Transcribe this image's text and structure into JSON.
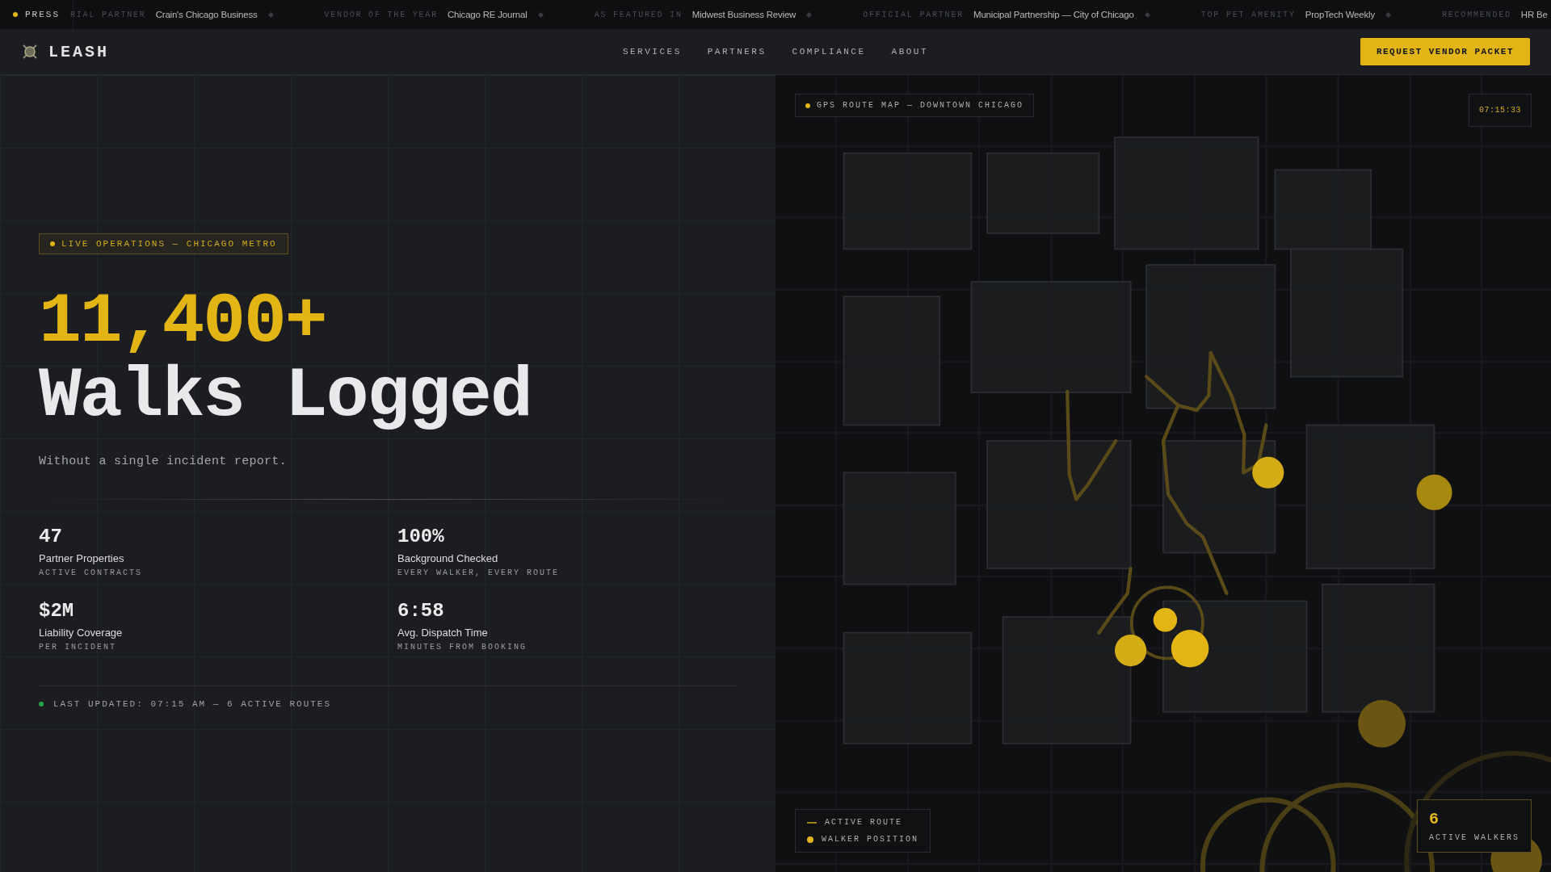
{
  "ticker": {
    "label": "PRESS",
    "items": [
      {
        "tag": "RIAL PARTNER",
        "source": "Crain's Chicago Business"
      },
      {
        "tag": "VENDOR OF THE YEAR",
        "source": "Chicago RE Journal"
      },
      {
        "tag": "AS FEATURED IN",
        "source": "Midwest Business Review"
      },
      {
        "tag": "OFFICIAL PARTNER",
        "source": "Municipal Partnership — City of Chicago"
      },
      {
        "tag": "TOP PET AMENITY",
        "source": "PropTech Weekly"
      },
      {
        "tag": "RECOMMENDED",
        "source": "HR Be"
      }
    ]
  },
  "nav": {
    "brand": "LEASH",
    "links": [
      "SERVICES",
      "PARTNERS",
      "COMPLIANCE",
      "ABOUT"
    ],
    "cta": "REQUEST VENDOR PACKET"
  },
  "hero": {
    "badge": "LIVE OPERATIONS — CHICAGO METRO",
    "figure": "11,400+",
    "headline": "Walks Logged",
    "subtitle": "Without a single incident report.",
    "stats": [
      {
        "value": "47",
        "label": "Partner Properties",
        "caption": "ACTIVE CONTRACTS"
      },
      {
        "value": "100%",
        "label": "Background Checked",
        "caption": "EVERY WALKER, EVERY ROUTE"
      },
      {
        "value": "$2M",
        "label": "Liability Coverage",
        "caption": "PER INCIDENT"
      },
      {
        "value": "6:58",
        "label": "Avg. Dispatch Time",
        "caption": "MINUTES FROM BOOKING"
      }
    ],
    "status": "LAST UPDATED: 07:15 AM — 6 ACTIVE ROUTES"
  },
  "map": {
    "title": "GPS ROUTE MAP — DOWNTOWN CHICAGO",
    "clock": "07:15:33",
    "legend": [
      {
        "kind": "line",
        "label": "ACTIVE ROUTE"
      },
      {
        "kind": "dot",
        "label": "WALKER POSITION"
      }
    ],
    "counter": {
      "value": "6",
      "label": "ACTIVE WALKERS"
    }
  }
}
